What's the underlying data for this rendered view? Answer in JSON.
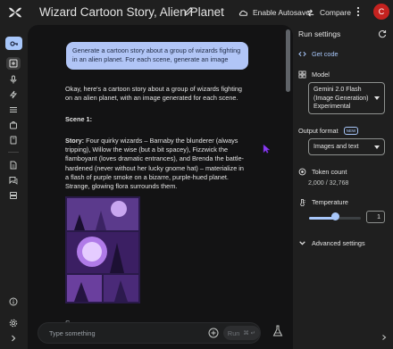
{
  "header": {
    "title": "Wizard Cartoon Story, Alien Planet",
    "autosave_label": "Enable Autosave",
    "compare_label": "Compare",
    "avatar_letter": "C"
  },
  "chat": {
    "user_prompt": "Generate a cartoon story about a group of wizards fighting in an alien planet. For each scene, generate an image",
    "intro": "Okay, here's a cartoon story about a group of wizards fighting on an alien planet, with an image generated for each scene.",
    "scene_heading": "Scene 1:",
    "story_label": "Story:",
    "story_text": " Four quirky wizards – Barnaby the blunderer (always tripping), Willow the wise (but a bit spacey), Fizzwick the flamboyant (loves dramatic entrances), and Brenda the battle-hardened (never without her lucky gnome hat) – materialize in a flash of purple smoke on a bizarre, purple-hued planet. Strange, glowing flora surrounds them.",
    "trailing_text": "S...",
    "input_placeholder": "Type something",
    "run_label": "Run",
    "run_shortcut": "⌘ ↵"
  },
  "run_settings": {
    "title": "Run settings",
    "get_code_label": "Get code",
    "model_label": "Model",
    "model_value": "Gemini 2.0 Flash (Image Generation) Experimental",
    "output_format_label": "Output format",
    "new_badge": "NEW",
    "output_format_value": "Images and text",
    "token_count_label": "Token count",
    "token_count_value": "2,000 / 32,768",
    "temperature_label": "Temperature",
    "temperature_value": "1",
    "temperature_fraction": 0.5,
    "advanced_label": "Advanced settings"
  }
}
